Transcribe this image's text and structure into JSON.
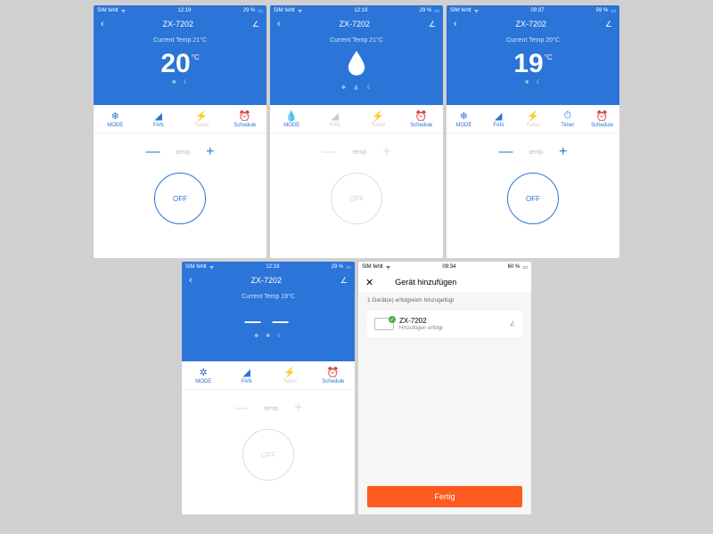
{
  "device_name": "ZX-7202",
  "labels": {
    "current_temp_21": "Current Temp 21°C",
    "current_temp_20": "Current Temp 20°C",
    "current_temp_19": "Current Temp 19°C",
    "temp": "temp",
    "off": "OFF",
    "mode": "MODE",
    "fan": "FAN",
    "turbo": "Turbo",
    "schedule": "Schedule",
    "timer": "Timer"
  },
  "screens": {
    "s1": {
      "big_temp": "20",
      "unit": "°C",
      "status_time": "12:19",
      "status_left": "SIM fehlt",
      "status_batt": "29 %"
    },
    "s2": {
      "status_time": "12:19",
      "status_left": "SIM fehlt",
      "status_batt": "29 %"
    },
    "s3": {
      "big_temp": "19",
      "unit": "°C",
      "status_time": "09:37",
      "status_left": "SIM fehlt",
      "status_batt": "59 %"
    },
    "s4": {
      "status_time": "12:19",
      "status_left": "SIM fehlt",
      "status_batt": "29 %"
    },
    "s5": {
      "status_time": "09:34",
      "status_left": "SIM fehlt",
      "status_batt": "60 %",
      "title": "Gerät hinzufügen",
      "success_msg": "1 Gerät(e) erfolgreich hinzugefügt",
      "dev_name": "ZX-7202",
      "dev_status": "Hinzufügen erfolgr.",
      "done": "Fertig"
    }
  },
  "icons": {
    "snowflake": "❄",
    "moon": "☾",
    "fan": "✲",
    "gear": "✿",
    "drop": "💧",
    "bars": "◢",
    "clock": "⏱",
    "alarm": "⏰",
    "wifi": "ᯤ"
  }
}
